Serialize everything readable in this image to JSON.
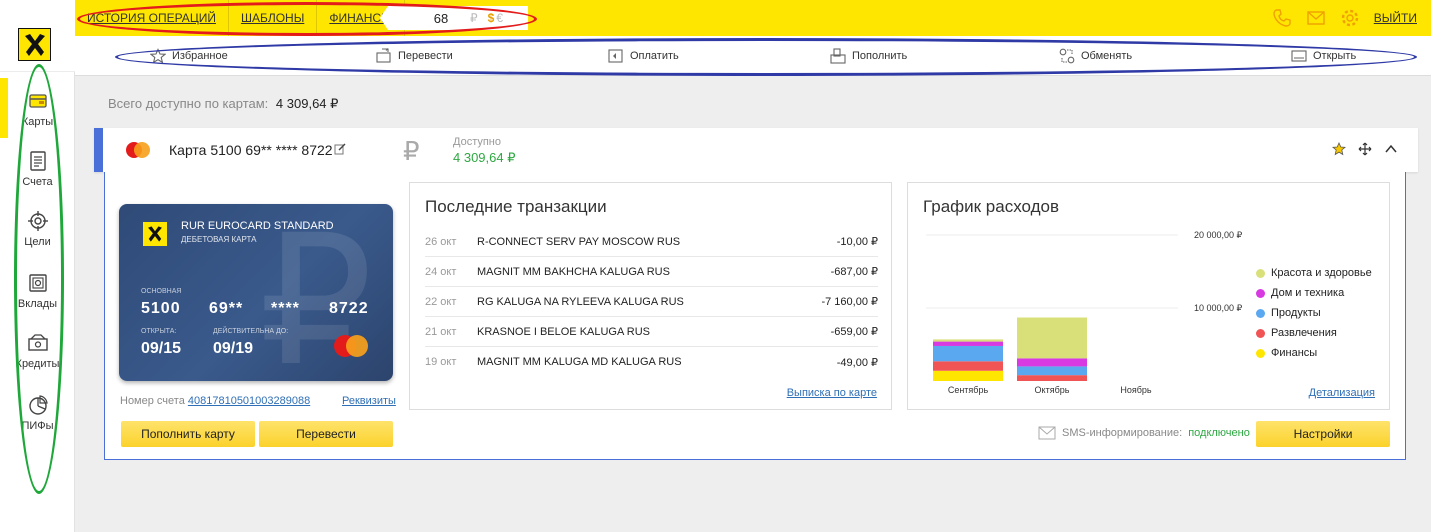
{
  "header": {
    "nav": [
      "ИСТОРИЯ ОПЕРАЦИЙ",
      "ШАБЛОНЫ",
      "ФИНАНСЫ"
    ],
    "rate_value": "68",
    "currencies": [
      "₽",
      "$",
      "€"
    ],
    "logout_label": "ВЫЙТИ",
    "icon_color": "#f0a000",
    "brand_color": "#fee600"
  },
  "actions": [
    {
      "label": "Избранное",
      "icon": "star-outline-icon"
    },
    {
      "label": "Перевести",
      "icon": "transfer-icon"
    },
    {
      "label": "Оплатить",
      "icon": "pay-icon"
    },
    {
      "label": "Пополнить",
      "icon": "top-up-icon"
    },
    {
      "label": "Обменять",
      "icon": "exchange-icon"
    },
    {
      "label": "Открыть",
      "icon": "open-account-icon"
    }
  ],
  "sidebar": {
    "items": [
      {
        "label": "Карты",
        "icon": "card-icon",
        "active": true
      },
      {
        "label": "Счета",
        "icon": "document-icon"
      },
      {
        "label": "Цели",
        "icon": "target-icon"
      },
      {
        "label": "Вклады",
        "icon": "safe-icon"
      },
      {
        "label": "Кредиты",
        "icon": "money-icon"
      },
      {
        "label": "ПИФы",
        "icon": "pie-icon"
      }
    ]
  },
  "summary": {
    "label": "Всего доступно по картам:",
    "value": "4 309,64 ₽"
  },
  "card_panel": {
    "title": "Карта 5100 69** **** 8722",
    "currency_symbol": "₽",
    "available_label": "Доступно",
    "available_value": "4 309,64 ₽"
  },
  "bank_card": {
    "product": "RUR EUROCARD STANDARD",
    "type": "ДЕБЕТОВАЯ КАРТА",
    "main_label": "ОСНОВНАЯ",
    "number_parts": [
      "5100",
      "69**",
      "****",
      "8722"
    ],
    "opened_label": "ОТКРЫТА:",
    "opened": "09/15",
    "valid_label": "ДЕЙСТВИТЕЛЬНА ДО:",
    "valid": "09/19",
    "bg_symbol": "₽"
  },
  "account": {
    "label": "Номер счета",
    "number": "40817810501003289088",
    "requisites": "Реквизиты"
  },
  "buttons": {
    "topup": "Пополнить карту",
    "transfer": "Перевести",
    "settings": "Настройки"
  },
  "transactions": {
    "title": "Последние транзакции",
    "rows": [
      {
        "date": "26 окт",
        "desc": "R-CONNECT SERV PAY MOSCOW RUS",
        "amount": "-10,00 ₽"
      },
      {
        "date": "24 окт",
        "desc": "MAGNIT MM BAKHCHA KALUGA RUS",
        "amount": "-687,00 ₽"
      },
      {
        "date": "22 окт",
        "desc": "RG KALUGA NA RYLEEVA KALUGA RUS",
        "amount": "-7 160,00 ₽"
      },
      {
        "date": "21 окт",
        "desc": "KRASNOE I BELOE KALUGA RUS",
        "amount": "-659,00 ₽"
      },
      {
        "date": "19 окт",
        "desc": "MAGNIT MM KALUGA MD KALUGA RUS",
        "amount": "-49,00 ₽"
      }
    ],
    "link": "Выписка по карте"
  },
  "chart_data": {
    "type": "bar",
    "title": "График расходов",
    "categories": [
      "Сентябрь",
      "Октябрь",
      "Ноябрь"
    ],
    "ytick_labels": [
      "20 000,00 ₽",
      "10 000,00 ₽"
    ],
    "yticks": [
      20000,
      10000
    ],
    "ylim": [
      0,
      20000
    ],
    "stacked": true,
    "legend_position": "right",
    "series": [
      {
        "name": "Финансы",
        "color": "#ffe600",
        "values": [
          1400,
          0,
          0
        ]
      },
      {
        "name": "Развлечения",
        "color": "#f05454",
        "values": [
          1300,
          800,
          0
        ]
      },
      {
        "name": "Продукты",
        "color": "#5aa9f0",
        "values": [
          2100,
          1200,
          0
        ]
      },
      {
        "name": "Дом и техника",
        "color": "#d63ae0",
        "values": [
          600,
          1100,
          0
        ]
      },
      {
        "name": "Красота и здоровье",
        "color": "#d9e07a",
        "values": [
          300,
          5600,
          0
        ]
      }
    ],
    "legend": [
      "Красота и здоровье",
      "Дом и техника",
      "Продукты",
      "Развлечения",
      "Финансы"
    ],
    "link": "Детализация"
  },
  "sms": {
    "label": "SMS-информирование:",
    "status": "подключено"
  }
}
